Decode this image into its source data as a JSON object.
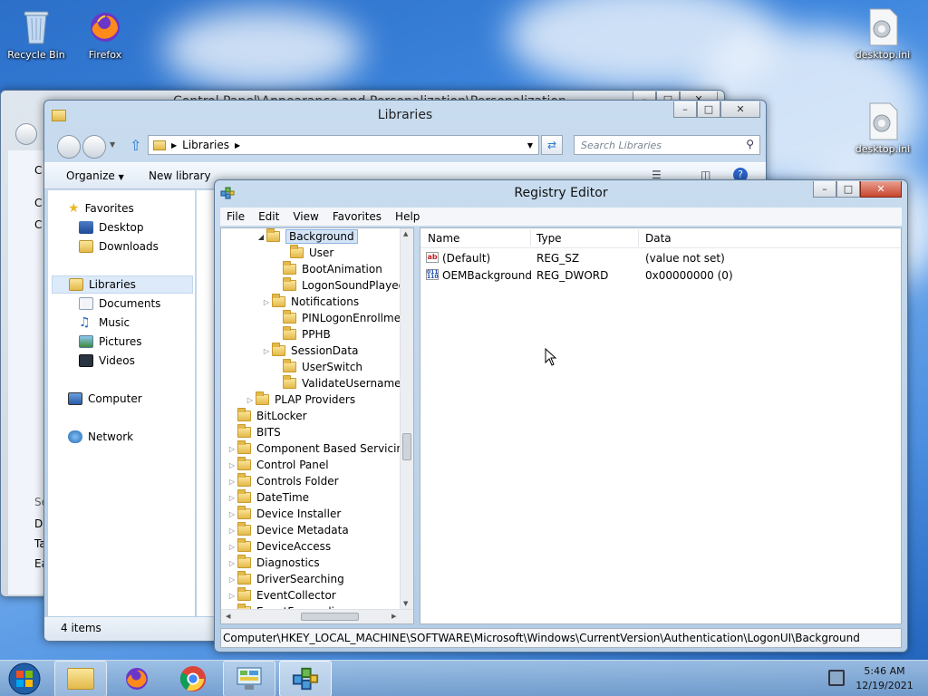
{
  "desktop": {
    "icons": [
      {
        "label": "Recycle Bin",
        "icon": "recycle-bin-icon"
      },
      {
        "label": "Firefox",
        "icon": "firefox-icon"
      },
      {
        "label": "desktop.ini",
        "icon": "settings-file-icon"
      },
      {
        "label": "desktop.ini",
        "icon": "settings-file-icon"
      }
    ]
  },
  "control_panel": {
    "title": "Control Panel\\Appearance and Personalization\\Personalization",
    "sidebar_fragments": [
      "C",
      "C",
      "C",
      "Se",
      "Di",
      "Ta",
      "Ea"
    ]
  },
  "libraries": {
    "title": "Libraries",
    "address": "Libraries",
    "search_placeholder": "Search Libraries",
    "toolbar": {
      "organize": "Organize",
      "new_library": "New library"
    },
    "nav": {
      "favorites": "Favorites",
      "desktop": "Desktop",
      "downloads": "Downloads",
      "libraries": "Libraries",
      "documents": "Documents",
      "music": "Music",
      "pictures": "Pictures",
      "videos": "Videos",
      "computer": "Computer",
      "network": "Network"
    },
    "status": "4 items"
  },
  "regedit": {
    "title": "Registry Editor",
    "menu": [
      "File",
      "Edit",
      "View",
      "Favorites",
      "Help"
    ],
    "tree": [
      {
        "label": "Background",
        "expanded": true,
        "selected": true
      },
      {
        "label": "User"
      },
      {
        "label": "BootAnimation"
      },
      {
        "label": "LogonSoundPlayed"
      },
      {
        "label": "Notifications",
        "has_children": true
      },
      {
        "label": "PINLogonEnrollment"
      },
      {
        "label": "PPHB"
      },
      {
        "label": "SessionData",
        "has_children": true
      },
      {
        "label": "UserSwitch"
      },
      {
        "label": "ValidateUsername"
      },
      {
        "label": "PLAP Providers",
        "has_children": true
      },
      {
        "label": "BitLocker"
      },
      {
        "label": "BITS"
      },
      {
        "label": "Component Based Servicing",
        "has_children": true
      },
      {
        "label": "Control Panel",
        "has_children": true
      },
      {
        "label": "Controls Folder",
        "has_children": true
      },
      {
        "label": "DateTime",
        "has_children": true
      },
      {
        "label": "Device Installer",
        "has_children": true
      },
      {
        "label": "Device Metadata",
        "has_children": true
      },
      {
        "label": "DeviceAccess",
        "has_children": true
      },
      {
        "label": "Diagnostics",
        "has_children": true
      },
      {
        "label": "DriverSearching",
        "has_children": true
      },
      {
        "label": "EventCollector",
        "has_children": true
      },
      {
        "label": "EventForwarding",
        "has_children": true
      }
    ],
    "columns": {
      "name": "Name",
      "type": "Type",
      "data": "Data"
    },
    "values": [
      {
        "name": "(Default)",
        "type": "REG_SZ",
        "data": "(value not set)",
        "icon": "string-value-icon"
      },
      {
        "name": "OEMBackground",
        "type": "REG_DWORD",
        "data": "0x00000000 (0)",
        "icon": "binary-value-icon"
      }
    ],
    "status_path": "Computer\\HKEY_LOCAL_MACHINE\\SOFTWARE\\Microsoft\\Windows\\CurrentVersion\\Authentication\\LogonUI\\Background"
  },
  "taskbar": {
    "items": [
      {
        "name": "file-explorer-taskbar-button",
        "icon": "folder-icon"
      },
      {
        "name": "firefox-taskbar-button",
        "icon": "firefox-icon"
      },
      {
        "name": "chrome-taskbar-button",
        "icon": "chrome-icon"
      },
      {
        "name": "control-panel-taskbar-button",
        "icon": "control-panel-icon"
      },
      {
        "name": "regedit-taskbar-button",
        "icon": "regedit-icon"
      }
    ],
    "time": "5:46 AM",
    "date": "12/19/2021"
  }
}
